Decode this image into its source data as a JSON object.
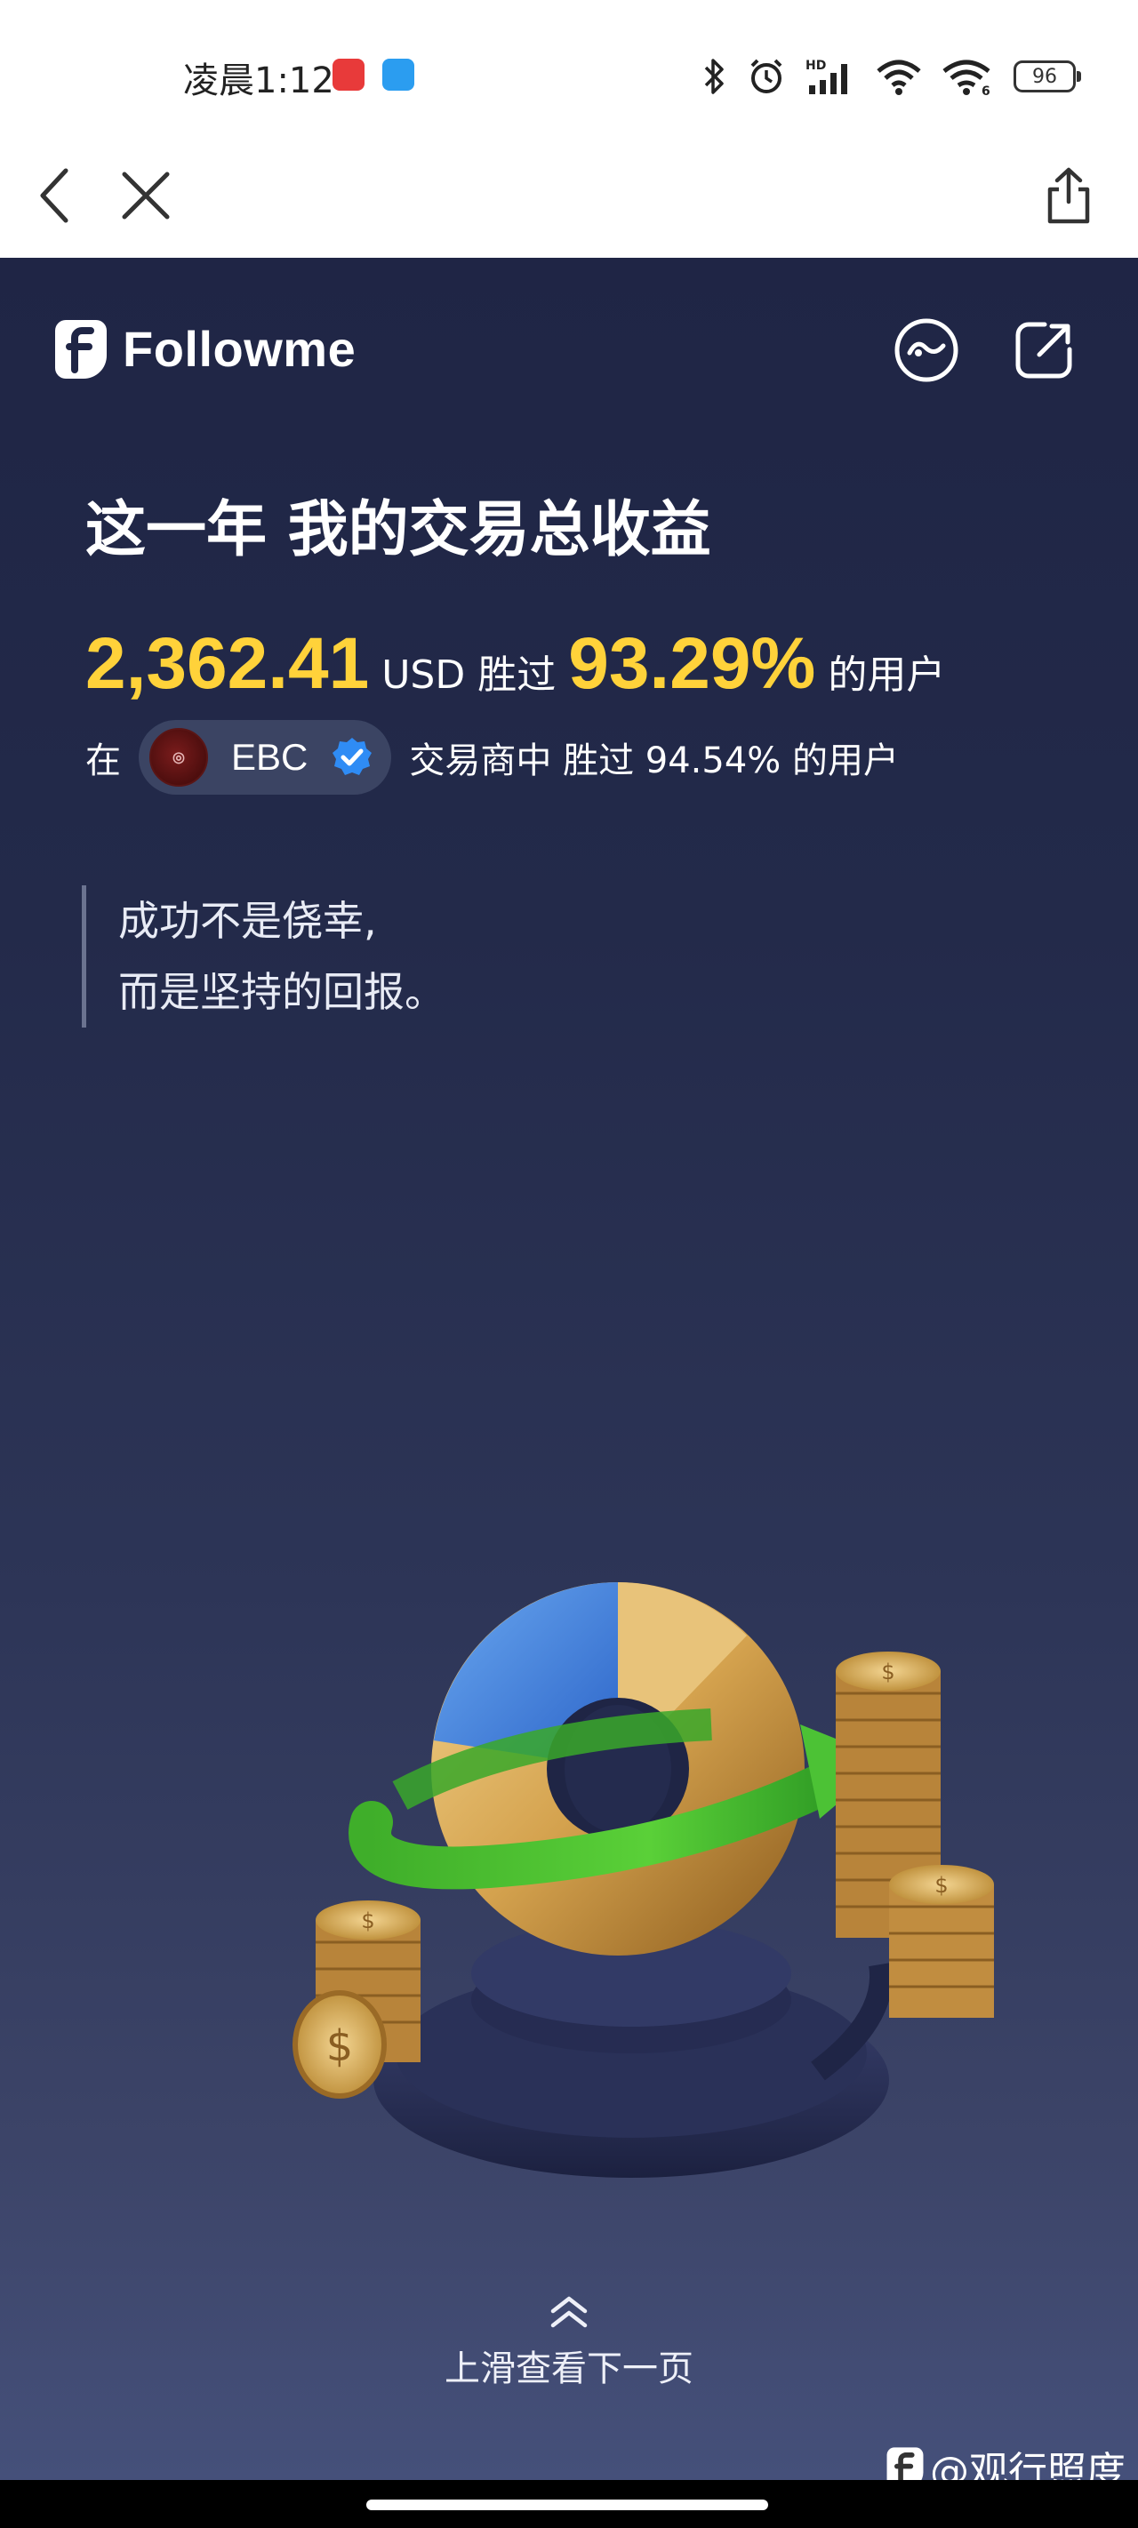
{
  "status_bar": {
    "time": "凌晨1:12",
    "battery": "96",
    "network_label": "HD"
  },
  "nav": {
    "back_icon": "chevron-left-icon",
    "close_icon": "close-icon",
    "share_icon": "share-icon"
  },
  "header": {
    "brand": "Followme",
    "game_icon": "game-controller-icon",
    "external_icon": "external-link-icon"
  },
  "summary": {
    "headline": "这一年 我的交易总收益",
    "amount": "2,362.41",
    "currency": "USD",
    "beat_label": "胜过",
    "beat_percent": "93.29%",
    "users_label": "的用户"
  },
  "broker": {
    "prefix": "在",
    "name": "EBC",
    "suffix": "交易商中 胜过 94.54% 的用户"
  },
  "quote": {
    "line1": "成功不是侥幸,",
    "line2": "而是坚持的回报。"
  },
  "footer": {
    "swipe_label": "上滑查看下一页",
    "watermark": "@观行照度"
  },
  "colors": {
    "accent": "#ffd23a",
    "background_top": "#1f2545",
    "background_bottom": "#45507a"
  }
}
